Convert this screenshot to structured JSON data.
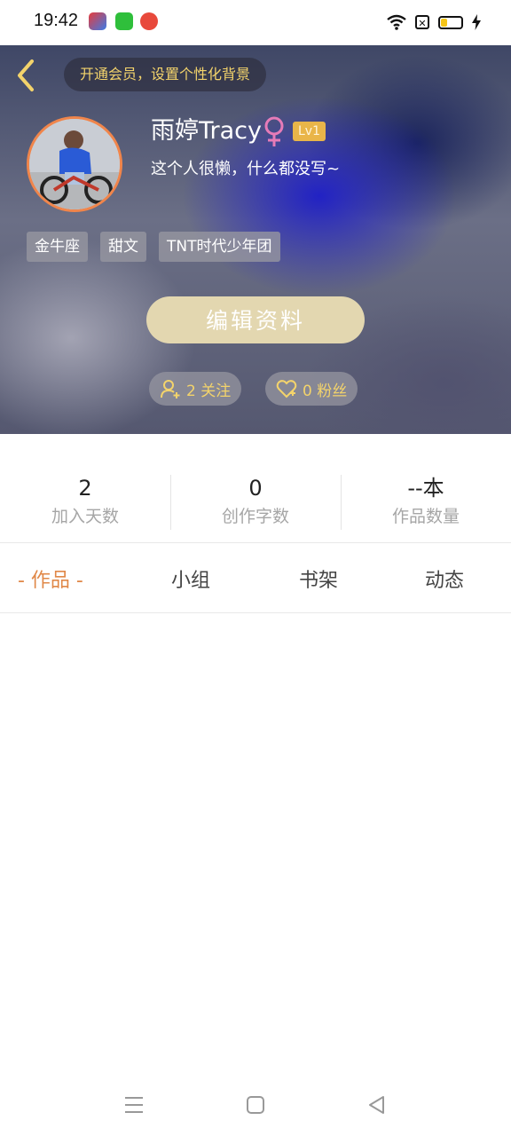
{
  "status_bar": {
    "time": "19:42"
  },
  "hero": {
    "vip_banner": "开通会员，设置个性化背景",
    "username": "雨婷Tracy",
    "level": "Lv1",
    "bio": "这个人很懒，什么都没写~",
    "tags": [
      "金牛座",
      "甜文",
      "TNT时代少年团"
    ],
    "edit_button": "编辑资料",
    "following": "2 关注",
    "fans": "0 粉丝"
  },
  "stats": [
    {
      "value": "2",
      "label": "加入天数"
    },
    {
      "value": "0",
      "label": "创作字数"
    },
    {
      "value": "--本",
      "label": "作品数量"
    }
  ],
  "tabs": [
    {
      "label": "- 作品 -",
      "active": true
    },
    {
      "label": "小组",
      "active": false
    },
    {
      "label": "书架",
      "active": false
    },
    {
      "label": "动态",
      "active": false
    }
  ],
  "colors": {
    "accent_orange": "#e08848",
    "gold": "#f3d36b",
    "edit_button_bg": "#e3d7b0",
    "level_badge_bg": "#e9b549"
  }
}
